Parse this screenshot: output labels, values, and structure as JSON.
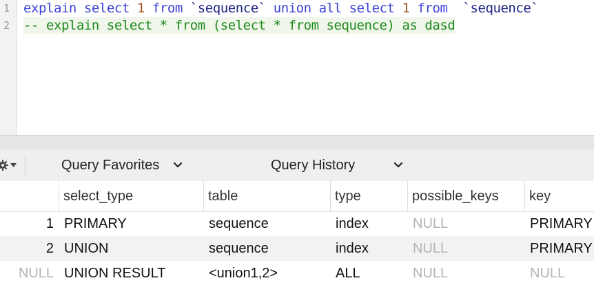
{
  "editor": {
    "line_numbers": [
      "1",
      "2"
    ],
    "line1": {
      "t1": "explain select",
      "t2": "1",
      "t3": "from",
      "t4": "`sequence`",
      "t5": "union all select",
      "t6": "1",
      "t7": "from",
      "t8": "`sequence`"
    },
    "line2": "-- explain select * from (select * from sequence) as dasd"
  },
  "toolbar": {
    "favorites_label": "Query Favorites",
    "history_label": "Query History"
  },
  "results": {
    "columns": [
      "select_type",
      "table",
      "type",
      "possible_keys",
      "key"
    ],
    "rows": [
      {
        "id": "1",
        "select_type": "PRIMARY",
        "table": "sequence",
        "type": "index",
        "possible_keys": "NULL",
        "key": "PRIMARY"
      },
      {
        "id": "2",
        "select_type": "UNION",
        "table": "sequence",
        "type": "index",
        "possible_keys": "NULL",
        "key": "PRIMARY"
      },
      {
        "id": "NULL",
        "select_type": "UNION RESULT",
        "table": "<union1,2>",
        "type": "ALL",
        "possible_keys": "NULL",
        "key": "NULL"
      }
    ]
  },
  "colors": {
    "keyword": "#3a41d6",
    "number": "#9e4f1e",
    "identifier": "#1d1f86",
    "comment": "#1c8a1c",
    "null_value": "#b4b4b4"
  },
  "icons": {
    "toolbar_gear": "gear-icon",
    "dropdown": "chevron-down-icon"
  }
}
